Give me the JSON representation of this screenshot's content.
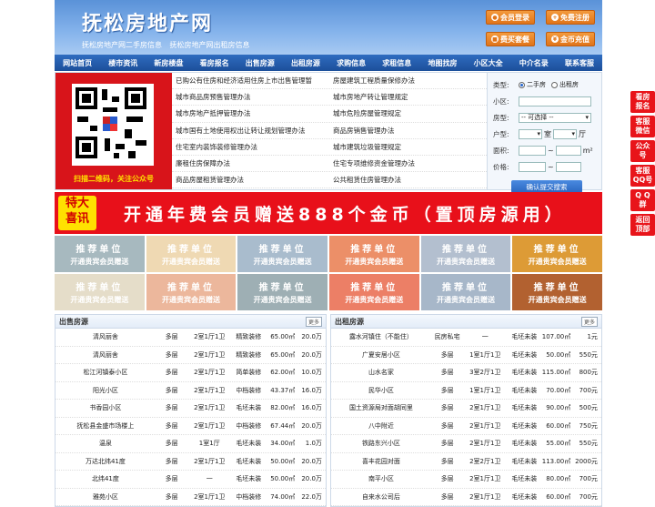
{
  "header": {
    "logo": "抚松房地产网",
    "sub_links": [
      "抚松房地产网二手房信息",
      "抚松房地产网出租房信息"
    ],
    "buttons": [
      "会员登录",
      "免费注册",
      "费买套餐",
      "金币充值"
    ]
  },
  "nav": [
    "网站首页",
    "楼市资讯",
    "新房楼盘",
    "看房报名",
    "出售房源",
    "出租房源",
    "求购信息",
    "求租信息",
    "地图找房",
    "小区大全",
    "中介名录",
    "联系客服"
  ],
  "qr_caption": "扫描二维码，关注公众号",
  "policy_links": [
    [
      "已购公有住房和经济适用住房上市出售管理暂",
      "房屋建筑工程质量保修办法"
    ],
    [
      "城市商品房预售管理办法",
      "城市房地产转让管理规定"
    ],
    [
      "城市房地产抵押管理办法",
      "城市危险房屋管理规定"
    ],
    [
      "城市国有土地使用权出让转让规划管理办法",
      "商品房销售管理办法"
    ],
    [
      "住宅室内装饰装修管理办法",
      "城市建筑垃圾管理规定"
    ],
    [
      "廉租住房保障办法",
      "住宅专项维修资金管理办法"
    ],
    [
      "商品房屋租赁管理办法",
      "公共租赁住房管理办法"
    ]
  ],
  "search": {
    "type_label": "类型:",
    "opt1": "二手房",
    "opt2": "出租房",
    "community_label": "小区:",
    "house_type_label": "房型:",
    "house_type_value": "-- 可选择 --",
    "layout_label": "户型:",
    "room": "室",
    "hall": "厅",
    "area_label": "面积:",
    "area_unit": "m²",
    "price_label": "价格:",
    "price_sep": "~",
    "submit": "确认提交搜索"
  },
  "banner": {
    "tag1": "特大",
    "tag2": "喜讯",
    "text": "开通年费会员赠送888个金币（置顶房源用）"
  },
  "tiles": {
    "title": "推荐单位",
    "subtitle": "开通贵宾会员赠送",
    "colors": [
      "#a7b9bf",
      "#efd9b3",
      "#a9bccd",
      "#ec8f68",
      "#b3bfcf",
      "#dd9b36",
      "#e5ddc9",
      "#ecb79c",
      "#9eafb4",
      "#ec7f66",
      "#a7b7c9",
      "#b26130"
    ]
  },
  "sale": {
    "title": "出售房源",
    "more": "更多",
    "rows": [
      [
        "清风丽舍",
        "多层",
        "2室1厅1卫",
        "精致装修",
        "65.00㎡",
        "20.0万"
      ],
      [
        "清风丽舍",
        "多层",
        "2室1厅1卫",
        "精致装修",
        "65.00㎡",
        "20.0万"
      ],
      [
        "松江河镇泰小区",
        "多层",
        "2室1厅1卫",
        "简单装修",
        "62.00㎡",
        "10.0万"
      ],
      [
        "阳光小区",
        "多层",
        "2室1厅1卫",
        "中档装修",
        "43.37㎡",
        "16.0万"
      ],
      [
        "书香园小区",
        "多层",
        "2室1厅1卫",
        "毛坯未装",
        "82.00㎡",
        "16.0万"
      ],
      [
        "抚松县金盛市场楼上",
        "多层",
        "2室1厅1卫",
        "中档装修",
        "67.44㎡",
        "20.0万"
      ],
      [
        "温泉",
        "多层",
        "1室1厅",
        "毛坯未装",
        "34.00㎡",
        "1.0万"
      ],
      [
        "万达北纬41度",
        "多层",
        "2室1厅1卫",
        "毛坯未装",
        "50.00㎡",
        "20.0万"
      ],
      [
        "北纬41度",
        "多层",
        "一",
        "毛坯未装",
        "50.00㎡",
        "20.0万"
      ],
      [
        "雅苑小区",
        "多层",
        "2室1厅1卫",
        "中档装修",
        "74.00㎡",
        "22.0万"
      ]
    ]
  },
  "rent": {
    "title": "出租房源",
    "more": "更多",
    "rows": [
      [
        "露水河镇住（不能住）",
        "民房私宅",
        "一",
        "毛坯未装",
        "107.00㎡",
        "1元"
      ],
      [
        "广夏安居小区",
        "多层",
        "1室1厅1卫",
        "毛坯未装",
        "50.00㎡",
        "550元"
      ],
      [
        "山水名家",
        "多层",
        "3室2厅1卫",
        "毛坯未装",
        "115.00㎡",
        "800元"
      ],
      [
        "民华小区",
        "多层",
        "1室1厅1卫",
        "毛坯未装",
        "70.00㎡",
        "700元"
      ],
      [
        "国土资源局对面胡同里",
        "多层",
        "2室1厅1卫",
        "毛坯未装",
        "90.00㎡",
        "500元"
      ],
      [
        "八中附近",
        "多层",
        "2室1厅1卫",
        "毛坯未装",
        "60.00㎡",
        "750元"
      ],
      [
        "铁路东兴小区",
        "多层",
        "2室1厅1卫",
        "毛坯未装",
        "55.00㎡",
        "550元"
      ],
      [
        "喜丰花园对面",
        "多层",
        "2室2厅1卫",
        "毛坯未装",
        "113.00㎡",
        "2000元"
      ],
      [
        "南平小区",
        "多层",
        "2室1厅1卫",
        "毛坯未装",
        "80.00㎡",
        "700元"
      ],
      [
        "自来水公司后",
        "多层",
        "2室1厅1卫",
        "毛坯未装",
        "60.00㎡",
        "700元"
      ]
    ]
  },
  "float": [
    "看房报名",
    "客服微信",
    "公众号",
    "客服QQ号",
    "QQ群",
    "返回顶部"
  ]
}
